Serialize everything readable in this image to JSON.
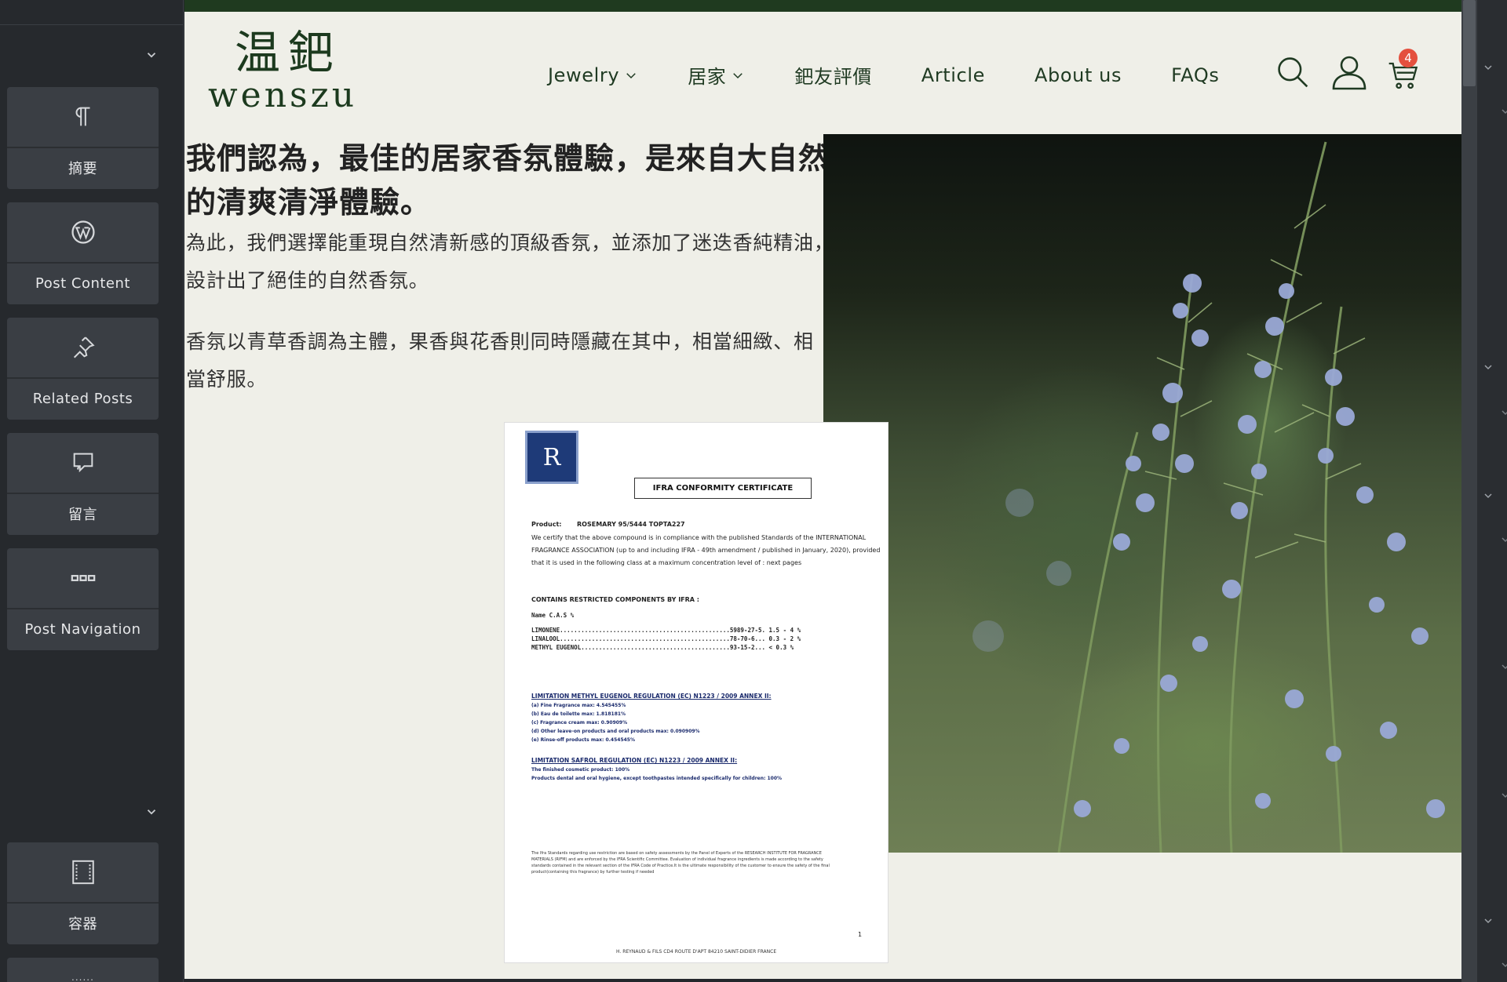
{
  "panel": {
    "widgets": [
      {
        "label": "摘要",
        "icon": "paragraph-icon"
      },
      {
        "label": "Post Content",
        "icon": "wordpress-icon"
      },
      {
        "label": "Related Posts",
        "icon": "pin-icon"
      },
      {
        "label": "留言",
        "icon": "comments-icon"
      },
      {
        "label": "Post Navigation",
        "icon": "post-navigation-icon"
      },
      {
        "label": "容器",
        "icon": "container-icon"
      }
    ],
    "next_widget_hint": "......"
  },
  "site": {
    "logo_cn": "温鈀",
    "logo_en": "wenszu",
    "nav": [
      {
        "label": "Jewelry",
        "has_dropdown": true
      },
      {
        "label": "居家",
        "has_dropdown": true
      },
      {
        "label": "鈀友評價",
        "has_dropdown": false
      },
      {
        "label": "Article",
        "has_dropdown": false
      },
      {
        "label": "About us",
        "has_dropdown": false
      },
      {
        "label": "FAQs",
        "has_dropdown": false
      }
    ],
    "cart_count": "4",
    "colors": {
      "brand": "#1c3a1e",
      "badge": "#e4503e",
      "background": "#efefe8"
    }
  },
  "content": {
    "headline": "我們認為，最佳的居家香氛體驗，是來自大自然的清爽清淨體驗。",
    "paragraph1": "為此，我們選擇能重現自然清新感的頂級香氛，並添加了迷迭香純精油，設計出了絕佳的自然香氛。",
    "paragraph2": "香氛以青草香調為主體，果香與花香則同時隱藏在其中，相當細緻、相當舒服。"
  },
  "certificate": {
    "title": "IFRA CONFORMITY CERTIFICATE",
    "product_label": "Product:",
    "product": "ROSEMARY 95/5444 TOPTA227",
    "intro": [
      "We certify that the above compound is in compliance with the published Standards of the INTERNATIONAL",
      "FRAGRANCE ASSOCIATION (up to and including IFRA - 49th amendment / published in January, 2020), provided",
      "that it is used in the following class at a maximum concentration level of : next pages"
    ],
    "restricted_heading": "CONTAINS RESTRICTED COMPONENTS BY IFRA :",
    "table_header": "Name                                                          C.A.S      %",
    "rows": [
      "LIMONENE................................................5989-27-5.  1.5 - 4 %",
      "LINALOOL................................................78-70-6...  0.3 - 2 %",
      "METHYL EUGENOL..........................................93-15-2...  < 0.3 %"
    ],
    "methyl_heading": "LIMITATION METHYL EUGENOL REGULATION (EC) N1223 / 2009 ANNEX II:",
    "methyl_items": [
      "(a) Fine Fragrance max: 4.545455%",
      "(b) Eau de toilette max: 1.818181%",
      "(c) Fragrance cream max: 0.90909%",
      "(d) Other leave-on products and oral products max: 0.090909%",
      "(e) Rinse-off products max: 0.454545%"
    ],
    "safrol_heading": "LIMITATION SAFROL REGULATION (EC) N1223 / 2009 ANNEX II:",
    "safrol_items": [
      "The finished cosmetic product:  100%",
      "Products dental and oral hygiene, except toothpastes intended specifically for children:  100%"
    ],
    "footnote": [
      "The Ifra Standards regarding use restriction are based on safety assessments by the Panel of Experts of the RESEARCH INSTITUTE FOR FRAGRANCE",
      "MATERIALS (RIFM) and are enforced by the IFRA Scientific Committee. Evaluation of individual fragrance ingredients is made according to the safety",
      "standards contained in the relevant section of the IFRA Code of Practice.It is the ultimate responsibility of the customer to ensure the safety of the final",
      "product(containing this fragrance) by further testing if needed"
    ],
    "page_number": "1",
    "address": "H. REYNAUD & FILS CD4 ROUTE D'APT 84210 SAINT-DIDIER FRANCE"
  }
}
